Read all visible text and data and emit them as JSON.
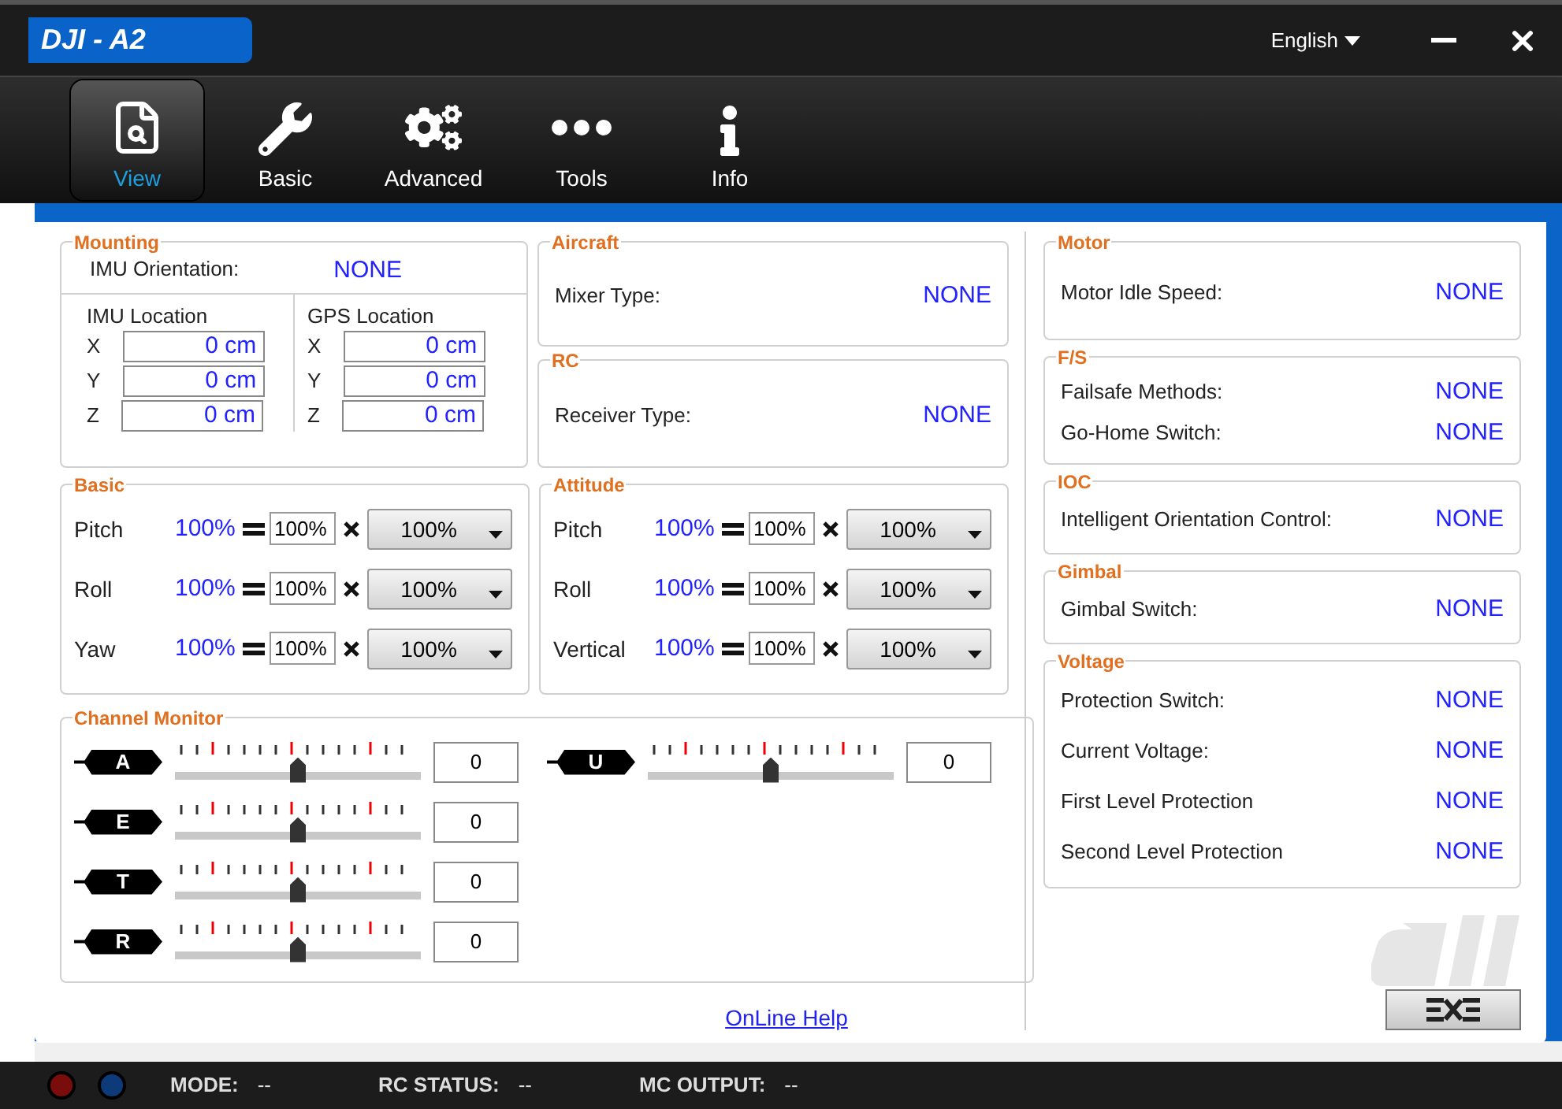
{
  "app": {
    "title": "DJI - A2",
    "language": "English"
  },
  "toolbar": [
    {
      "label": "View",
      "selected": true
    },
    {
      "label": "Basic",
      "selected": false
    },
    {
      "label": "Advanced",
      "selected": false
    },
    {
      "label": "Tools",
      "selected": false
    },
    {
      "label": "Info",
      "selected": false
    }
  ],
  "mounting": {
    "title": "Mounting",
    "orientation": {
      "label": "IMU Orientation:",
      "value": "NONE"
    },
    "locations": [
      {
        "title": "IMU Location",
        "axes": [
          {
            "axis": "X",
            "value": "0 cm"
          },
          {
            "axis": "Y",
            "value": "0 cm"
          },
          {
            "axis": "Z",
            "value": "0 cm"
          }
        ]
      },
      {
        "title": "GPS Location",
        "axes": [
          {
            "axis": "X",
            "value": "0 cm"
          },
          {
            "axis": "Y",
            "value": "0 cm"
          },
          {
            "axis": "Z",
            "value": "0 cm"
          }
        ]
      }
    ]
  },
  "aircraft": {
    "title": "Aircraft",
    "rows": [
      {
        "label": "Mixer Type:",
        "value": "NONE"
      }
    ]
  },
  "rc": {
    "title": "RC",
    "rows": [
      {
        "label": "Receiver Type:",
        "value": "NONE"
      }
    ]
  },
  "gains": [
    {
      "title": "Basic",
      "rows": [
        {
          "label": "Pitch",
          "result": "100%",
          "gain": "100%",
          "multiplier": "100%"
        },
        {
          "label": "Roll",
          "result": "100%",
          "gain": "100%",
          "multiplier": "100%"
        },
        {
          "label": "Yaw",
          "result": "100%",
          "gain": "100%",
          "multiplier": "100%"
        }
      ]
    },
    {
      "title": "Attitude",
      "rows": [
        {
          "label": "Pitch",
          "result": "100%",
          "gain": "100%",
          "multiplier": "100%"
        },
        {
          "label": "Roll",
          "result": "100%",
          "gain": "100%",
          "multiplier": "100%"
        },
        {
          "label": "Vertical",
          "result": "100%",
          "gain": "100%",
          "multiplier": "100%"
        }
      ]
    }
  ],
  "channel_monitor": {
    "title": "Channel Monitor",
    "channels": [
      {
        "name": "A",
        "level": 0.5,
        "value": "0"
      },
      {
        "name": "E",
        "level": 0.5,
        "value": "0"
      },
      {
        "name": "T",
        "level": 0.5,
        "value": "0"
      },
      {
        "name": "R",
        "level": 0.5,
        "value": "0"
      },
      {
        "name": "U",
        "level": 0.5,
        "value": "0"
      }
    ]
  },
  "online_help": "OnLine Help",
  "right_panels": [
    {
      "title": "Motor",
      "rows": [
        {
          "label": "Motor Idle Speed:",
          "value": "NONE"
        }
      ]
    },
    {
      "title": "F/S",
      "rows": [
        {
          "label": "Failsafe Methods:",
          "value": "NONE"
        },
        {
          "label": "Go-Home Switch:",
          "value": "NONE"
        }
      ]
    },
    {
      "title": "IOC",
      "rows": [
        {
          "label": "Intelligent Orientation Control:",
          "value": "NONE"
        }
      ]
    },
    {
      "title": "Gimbal",
      "rows": [
        {
          "label": "Gimbal Switch:",
          "value": "NONE"
        }
      ]
    },
    {
      "title": "Voltage",
      "rows": [
        {
          "label": "Protection Switch:",
          "value": "NONE"
        },
        {
          "label": "Current Voltage:",
          "value": "NONE"
        },
        {
          "label": "First Level Protection",
          "value": "NONE"
        },
        {
          "label": "Second Level Protection",
          "value": "NONE"
        }
      ]
    }
  ],
  "status_bar": {
    "leds": [
      {
        "color": "#7a0c0c"
      },
      {
        "color": "#0d3a78"
      }
    ],
    "items": [
      {
        "label": "MODE:",
        "value": "--"
      },
      {
        "label": "RC STATUS:",
        "value": "--"
      },
      {
        "label": "MC OUTPUT:",
        "value": "--"
      }
    ]
  }
}
